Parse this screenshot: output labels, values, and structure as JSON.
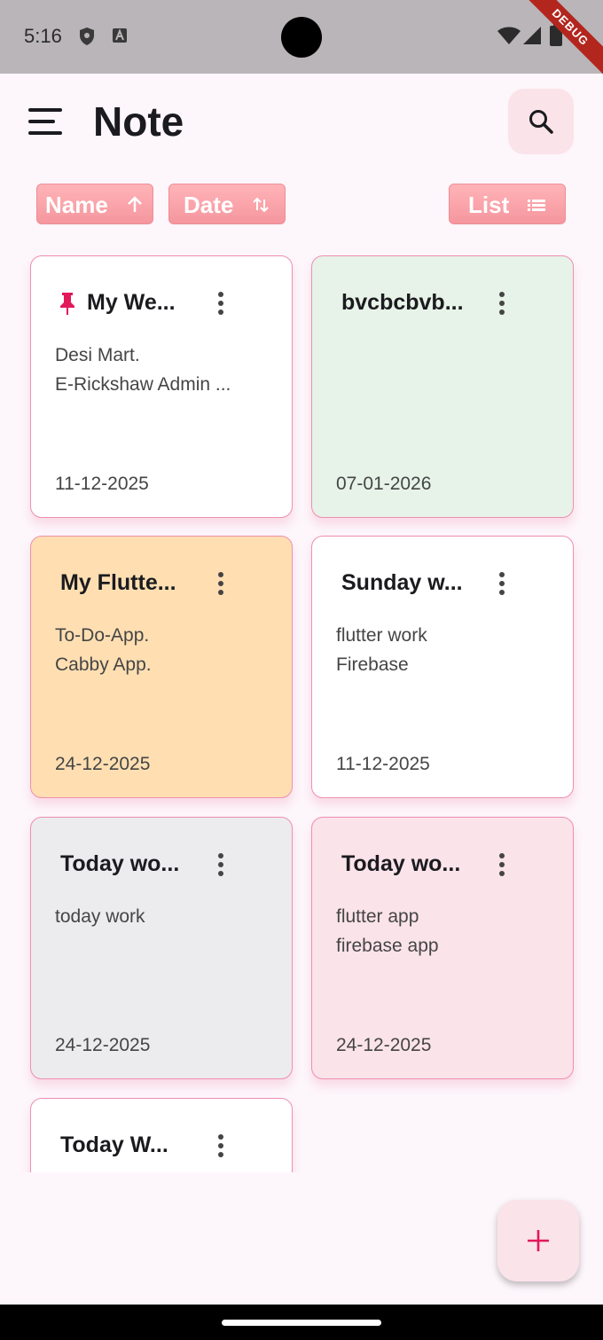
{
  "status_bar": {
    "time": "5:16",
    "debug_label": "DEBUG"
  },
  "app_bar": {
    "title": "Note",
    "menu_icon": "menu-icon",
    "search_icon": "search-icon"
  },
  "sort_bar": {
    "name_label": "Name",
    "name_icon": "arrow-up-icon",
    "date_label": "Date",
    "date_icon": "swap-vert-icon",
    "view_label": "List",
    "view_icon": "list-icon"
  },
  "notes": [
    {
      "title": "My We...",
      "body_line1": "Desi Mart.",
      "body_line2": "E-Rickshaw Admin ...",
      "date": "11-12-2025",
      "pinned": true,
      "bg": "#ffffff"
    },
    {
      "title": "bvcbcbvb...",
      "body_line1": "",
      "body_line2": "",
      "date": "07-01-2026",
      "pinned": false,
      "bg": "#e7f3e8"
    },
    {
      "title": "My Flutte...",
      "body_line1": "To-Do-App.",
      "body_line2": "Cabby App.",
      "date": "24-12-2025",
      "pinned": false,
      "bg": "#ffdfb2"
    },
    {
      "title": "Sunday w...",
      "body_line1": "flutter work",
      "body_line2": "Firebase",
      "date": "11-12-2025",
      "pinned": false,
      "bg": "#ffffff"
    },
    {
      "title": "Today wo...",
      "body_line1": "today work",
      "body_line2": "",
      "date": "24-12-2025",
      "pinned": false,
      "bg": "#ececee"
    },
    {
      "title": "Today wo...",
      "body_line1": "flutter app",
      "body_line2": "firebase app",
      "date": "24-12-2025",
      "pinned": false,
      "bg": "#fbe3ea"
    },
    {
      "title": "Today W...",
      "body_line1": "",
      "body_line2": "",
      "date": "",
      "pinned": false,
      "bg": "#ffffff"
    }
  ],
  "fab": {
    "icon": "add-icon"
  },
  "colors": {
    "accent": "#e2185b",
    "chip": "#f5969e",
    "background": "#fdf6fb"
  }
}
